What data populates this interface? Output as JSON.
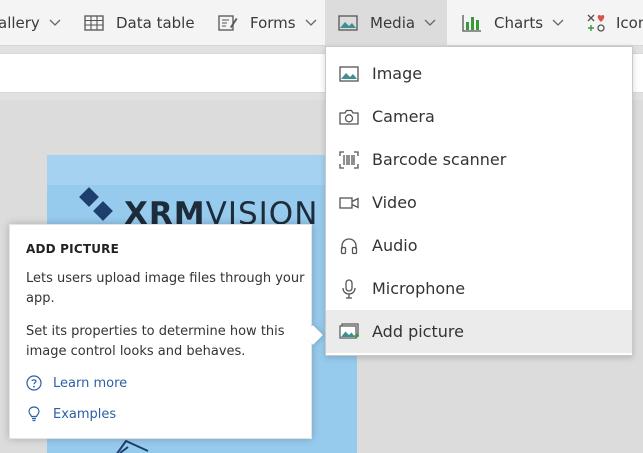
{
  "ribbon": {
    "tabs": [
      {
        "label": "allery",
        "icon": "gallery-icon"
      },
      {
        "label": "Data table",
        "icon": "data-table-icon"
      },
      {
        "label": "Forms",
        "icon": "forms-icon"
      },
      {
        "label": "Media",
        "icon": "media-icon",
        "active": true
      },
      {
        "label": "Charts",
        "icon": "charts-icon"
      },
      {
        "label": "Icon",
        "icon": "icons-icon"
      }
    ]
  },
  "media_menu": {
    "items": [
      {
        "label": "Image",
        "icon": "image-icon"
      },
      {
        "label": "Camera",
        "icon": "camera-icon"
      },
      {
        "label": "Barcode scanner",
        "icon": "barcode-icon"
      },
      {
        "label": "Video",
        "icon": "video-icon"
      },
      {
        "label": "Audio",
        "icon": "headphones-icon"
      },
      {
        "label": "Microphone",
        "icon": "microphone-icon"
      },
      {
        "label": "Add picture",
        "icon": "add-picture-icon",
        "hovered": true
      }
    ]
  },
  "tooltip": {
    "title": "ADD PICTURE",
    "description": "Lets users upload image files through your app.",
    "properties": "Set its properties to determine how this image control looks and behaves.",
    "learn_more": "Learn more",
    "examples": "Examples"
  },
  "canvas": {
    "logo_bold": "XRM",
    "logo_light": "VISION"
  },
  "colors": {
    "accent_link": "#2b5fa6",
    "chart_green": "#3a9a3a",
    "screen_blue": "#97cbee",
    "logo_navy": "#1d3f6e"
  }
}
